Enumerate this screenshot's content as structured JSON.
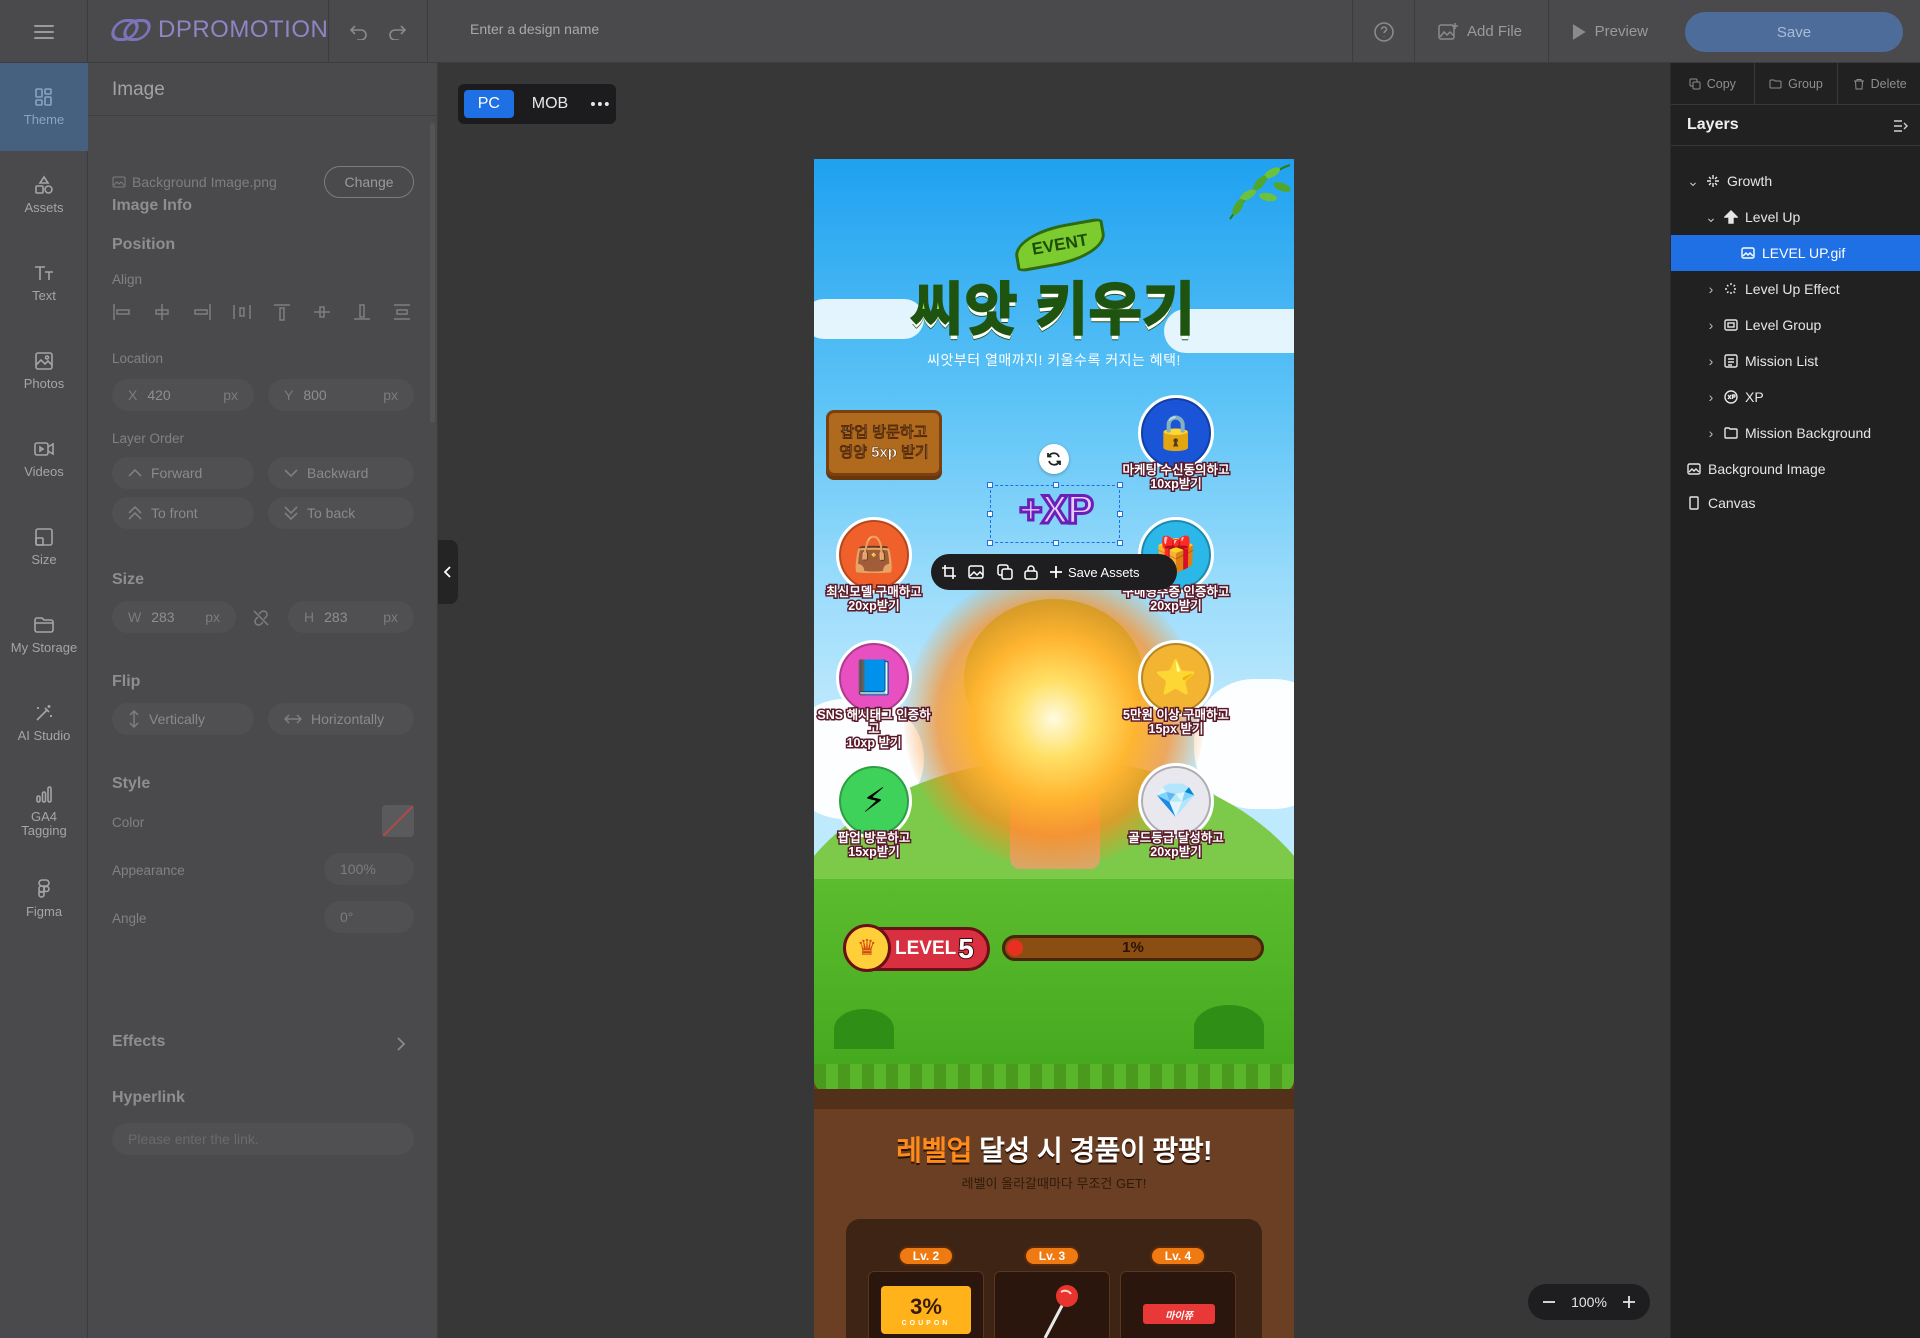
{
  "app": {
    "logo_text": "DPROMOTION",
    "design_name_placeholder": "Enter a design name",
    "add_file_label": "Add File",
    "preview_label": "Preview",
    "save_label": "Save"
  },
  "rail": {
    "items": [
      {
        "label": "Theme",
        "icon": "theme-icon"
      },
      {
        "label": "Assets",
        "icon": "assets-icon"
      },
      {
        "label": "Text",
        "icon": "text-icon"
      },
      {
        "label": "Photos",
        "icon": "photos-icon"
      },
      {
        "label": "Videos",
        "icon": "videos-icon"
      },
      {
        "label": "Size",
        "icon": "size-icon"
      },
      {
        "label": "My Storage",
        "icon": "folder-icon"
      },
      {
        "label": "AI Studio",
        "icon": "magic-wand-icon"
      },
      {
        "label": "GA4 Tagging",
        "icon": "analytics-icon"
      },
      {
        "label": "Figma",
        "icon": "figma-icon"
      }
    ]
  },
  "props": {
    "title": "Image",
    "image_info": {
      "section": "Image Info",
      "file_name": "Background Image.png",
      "change_label": "Change"
    },
    "position": {
      "section": "Position",
      "align_label": "Align",
      "location_label": "Location",
      "x_label": "X",
      "x_value": "420",
      "x_unit": "px",
      "y_label": "Y",
      "y_value": "800",
      "y_unit": "px",
      "layer_order_label": "Layer Order",
      "forward": "Forward",
      "backward": "Backward",
      "to_front": "To front",
      "to_back": "To back"
    },
    "size": {
      "section": "Size",
      "w_label": "W",
      "w_value": "283",
      "w_unit": "px",
      "h_label": "H",
      "h_value": "283",
      "h_unit": "px"
    },
    "flip": {
      "section": "Flip",
      "vertically": "Vertically",
      "horizontally": "Horizontally"
    },
    "style": {
      "section": "Style",
      "color_label": "Color",
      "appearance_label": "Appearance",
      "appearance_value": "100%",
      "angle_label": "Angle",
      "angle_value": "0°"
    },
    "effects_label": "Effects",
    "hyperlink": {
      "section": "Hyperlink",
      "placeholder": "Please enter the link."
    }
  },
  "canvas": {
    "device_pc": "PC",
    "device_mob": "MOB",
    "zoom": "100%",
    "float_toolbar": {
      "save_assets": "Save Assets"
    }
  },
  "event_page": {
    "event_tag": "EVENT",
    "title": "씨앗 키우기",
    "subtitle": "씨앗부터 열매까지! 키울수록 커지는 혜택!",
    "popup_mission": "팝업 방문하고\n영양 5xp 받기",
    "xp_text": "+XP",
    "missions": [
      {
        "label": "마케팅 수신동의하고\n10xp받기",
        "icon": "lock-icon",
        "color": "#1a55d8"
      },
      {
        "label": "최신모델 구매하고\n20xp받기",
        "icon": "shopping-bag-icon",
        "color": "#f0602a"
      },
      {
        "label": "구매영수증 인증하고\n20xp받기",
        "icon": "gift-icon",
        "color": "#2bb8e8"
      },
      {
        "label": "SNS 해시태그 인증하고\n10xp 받기",
        "icon": "book-icon",
        "color": "#e84fc0"
      },
      {
        "label": "5만원 이상 구매하고\n15px 받기",
        "icon": "star-coin-icon",
        "color": "#f2b431"
      },
      {
        "label": "팝업 방문하고\n15xp받기",
        "icon": "lightning-icon",
        "color": "#3fd25a"
      },
      {
        "label": "골드등급 달성하고\n20xp받기",
        "icon": "gem-icon",
        "color": "#e8e8ee"
      }
    ],
    "level_label": "LEVEL",
    "level_value": "5",
    "progress_text": "1%",
    "progress_value": 0.01,
    "reward_title_highlight": "레벨업",
    "reward_title_rest": " 달성 시 경품이 팡팡!",
    "reward_subtitle": "레벨이 올라갈때마다 무조건 GET!",
    "rewards": [
      {
        "level": "Lv. 2",
        "coupon": "3%",
        "coupon_caption": "COUPON"
      },
      {
        "level": "Lv. 3"
      },
      {
        "level": "Lv. 4",
        "snack": "마이쮸"
      }
    ]
  },
  "layers_panel": {
    "copy": "Copy",
    "group": "Group",
    "delete": "Delete",
    "title": "Layers",
    "items": [
      {
        "name": "Growth",
        "icon": "sparkle-icon"
      },
      {
        "name": "Level Up",
        "icon": "arrow-up-icon"
      },
      {
        "name": "LEVEL UP.gif",
        "icon": "image-icon",
        "selected": true
      },
      {
        "name": "Level Up Effect",
        "icon": "effect-icon"
      },
      {
        "name": "Level Group",
        "icon": "group-icon"
      },
      {
        "name": "Mission List",
        "icon": "list-icon"
      },
      {
        "name": "XP",
        "icon": "xp-icon"
      },
      {
        "name": "Mission Background",
        "icon": "folder-icon"
      },
      {
        "name": "Background Image",
        "icon": "image-icon"
      },
      {
        "name": "Canvas",
        "icon": "canvas-icon"
      }
    ]
  },
  "colors": {
    "accent": "#1f6fe5",
    "save_button": "#4d6c9a",
    "panel_bg": "#4a4a4c",
    "canvas_bg": "#373737"
  }
}
